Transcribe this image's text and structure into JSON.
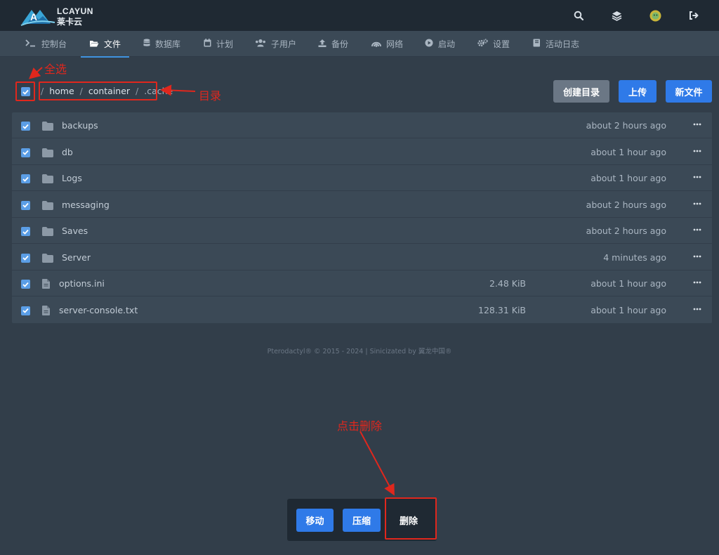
{
  "brand": {
    "name": "LCAYUN",
    "subtitle": "莱卡云"
  },
  "top_actions": [
    {
      "icon": "search-icon"
    },
    {
      "icon": "layers-icon"
    },
    {
      "icon": "avatar-icon"
    },
    {
      "icon": "logout-icon"
    }
  ],
  "nav": {
    "items": [
      {
        "label": "控制台",
        "icon": "terminal-icon"
      },
      {
        "label": "文件",
        "icon": "folder-open-icon",
        "active": true
      },
      {
        "label": "数据库",
        "icon": "database-icon"
      },
      {
        "label": "计划",
        "icon": "calendar-icon"
      },
      {
        "label": "子用户",
        "icon": "users-icon"
      },
      {
        "label": "备份",
        "icon": "upload-icon"
      },
      {
        "label": "网络",
        "icon": "network-icon"
      },
      {
        "label": "启动",
        "icon": "play-icon"
      },
      {
        "label": "设置",
        "icon": "cogs-icon"
      },
      {
        "label": "活动日志",
        "icon": "book-icon"
      }
    ]
  },
  "breadcrumb": {
    "segments": [
      "home",
      "container",
      ".cache"
    ]
  },
  "toolbar": {
    "create_dir": "创建目录",
    "upload": "上传",
    "new_file": "新文件"
  },
  "files": [
    {
      "name": "backups",
      "type": "folder",
      "size": "",
      "modified": "about 2 hours ago"
    },
    {
      "name": "db",
      "type": "folder",
      "size": "",
      "modified": "about 1 hour ago"
    },
    {
      "name": "Logs",
      "type": "folder",
      "size": "",
      "modified": "about 1 hour ago"
    },
    {
      "name": "messaging",
      "type": "folder",
      "size": "",
      "modified": "about 2 hours ago"
    },
    {
      "name": "Saves",
      "type": "folder",
      "size": "",
      "modified": "about 2 hours ago"
    },
    {
      "name": "Server",
      "type": "folder",
      "size": "",
      "modified": "4 minutes ago"
    },
    {
      "name": "options.ini",
      "type": "file",
      "size": "2.48 KiB",
      "modified": "about 1 hour ago"
    },
    {
      "name": "server-console.txt",
      "type": "file",
      "size": "128.31 KiB",
      "modified": "about 1 hour ago"
    }
  ],
  "footer": "Pterodactyl® © 2015 - 2024 | Sinicizated by 翼龙中国®",
  "bulk_actions": {
    "move": "移动",
    "compress": "压缩",
    "delete": "删除"
  },
  "annotations": {
    "select_all": "全选",
    "directory": "目录",
    "click_delete": "点击删除"
  },
  "colors": {
    "background": "#323e4a",
    "topbar": "#1f2933",
    "panel": "#3b4956",
    "accent_blue": "#2f7ae8",
    "checkbox": "#5b9ee6",
    "annotation_red": "#e0271d"
  }
}
